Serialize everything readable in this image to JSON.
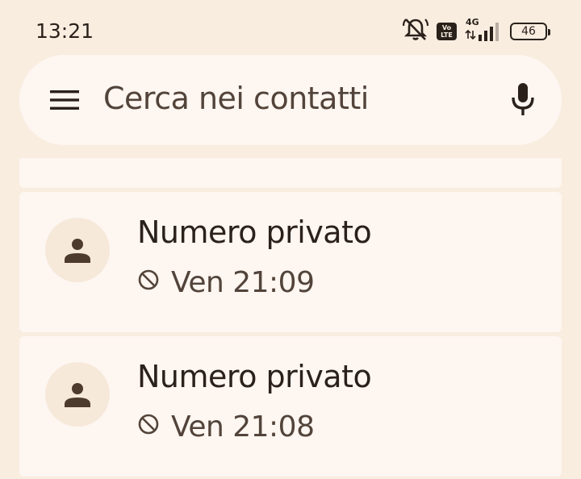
{
  "status_bar": {
    "time": "13:21",
    "volte_top": "Vo",
    "volte_bottom": "LTE",
    "network": "4G",
    "battery": "46"
  },
  "search": {
    "placeholder": "Cerca nei contatti",
    "menu_icon": "hamburger-menu-icon",
    "mic_icon": "microphone-icon"
  },
  "calls": [
    {
      "name": "Numero privato",
      "time": "Ven 21:09",
      "status_icon": "blocked-icon"
    },
    {
      "name": "Numero privato",
      "time": "Ven 21:08",
      "status_icon": "blocked-icon"
    }
  ],
  "colors": {
    "background": "#f9ede0",
    "surface": "#fef6f1",
    "text": "#2a211b",
    "secondary_text": "#52443a",
    "avatar_bg": "#f6e9da"
  }
}
